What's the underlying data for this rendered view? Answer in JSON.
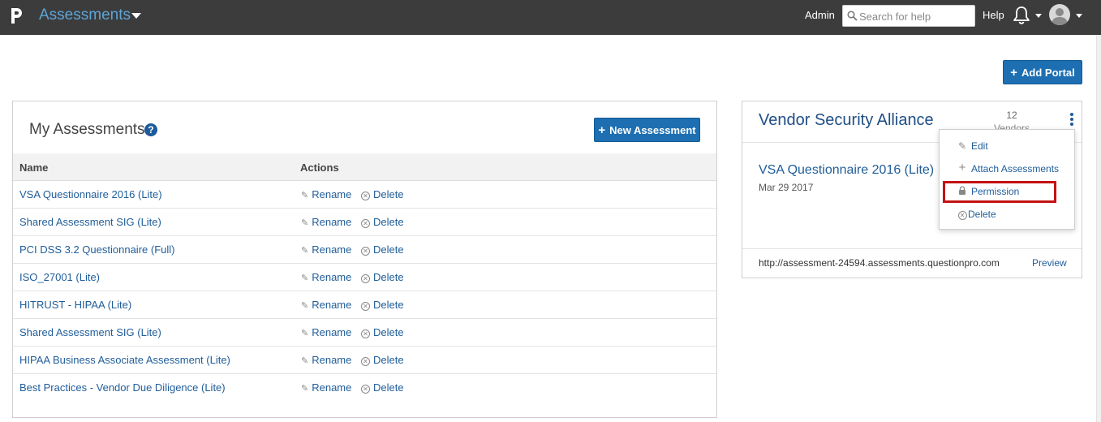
{
  "header": {
    "app_title": "Assessments",
    "admin_label": "Admin",
    "search_placeholder": "Search for help",
    "help_label": "Help"
  },
  "actions": {
    "add_portal_label": "Add Portal",
    "new_assessment_label": "New Assessment"
  },
  "assessments_panel": {
    "title": "My Assessments",
    "help_glyph": "?",
    "columns": [
      "Name",
      "Actions"
    ],
    "rows": [
      {
        "name": "VSA Questionnaire 2016 (Lite)",
        "rename": "Rename",
        "delete": "Delete"
      },
      {
        "name": "Shared Assessment SIG (Lite)",
        "rename": "Rename",
        "delete": "Delete"
      },
      {
        "name": "PCI DSS 3.2 Questionnaire (Full)",
        "rename": "Rename",
        "delete": "Delete"
      },
      {
        "name": "ISO_27001 (Lite)",
        "rename": "Rename",
        "delete": "Delete"
      },
      {
        "name": "HITRUST - HIPAA (Lite)",
        "rename": "Rename",
        "delete": "Delete"
      },
      {
        "name": "Shared Assessment SIG (Lite)",
        "rename": "Rename",
        "delete": "Delete"
      },
      {
        "name": "HIPAA Business Associate Assessment (Lite)",
        "rename": "Rename",
        "delete": "Delete"
      },
      {
        "name": "Best Practices - Vendor Due Diligence (Lite)",
        "rename": "Rename",
        "delete": "Delete"
      }
    ]
  },
  "portal_card": {
    "title": "Vendor Security Alliance",
    "vendor_count": "12",
    "vendor_label": "Vendors",
    "assessment_link": "VSA Questionnaire 2016 (Lite)",
    "date": "Mar 29 2017",
    "url": "http://assessment-24594.assessments.questionpro.com",
    "preview_label": "Preview"
  },
  "portal_menu": {
    "items": [
      {
        "label": "Edit",
        "icon": "edit-icon"
      },
      {
        "label": "Attach Assessments",
        "icon": "plus-icon"
      },
      {
        "label": "Permission",
        "icon": "lock-icon"
      },
      {
        "label": "Delete",
        "icon": "delete-circle-icon"
      }
    ],
    "highlighted_item": "Permission",
    "highlight_color": "#c41212"
  },
  "colors": {
    "topbar": "#3c3c3c",
    "brand_link": "#5ca5d9",
    "primary_button": "#1d6fb2",
    "link": "#1f5d99"
  }
}
